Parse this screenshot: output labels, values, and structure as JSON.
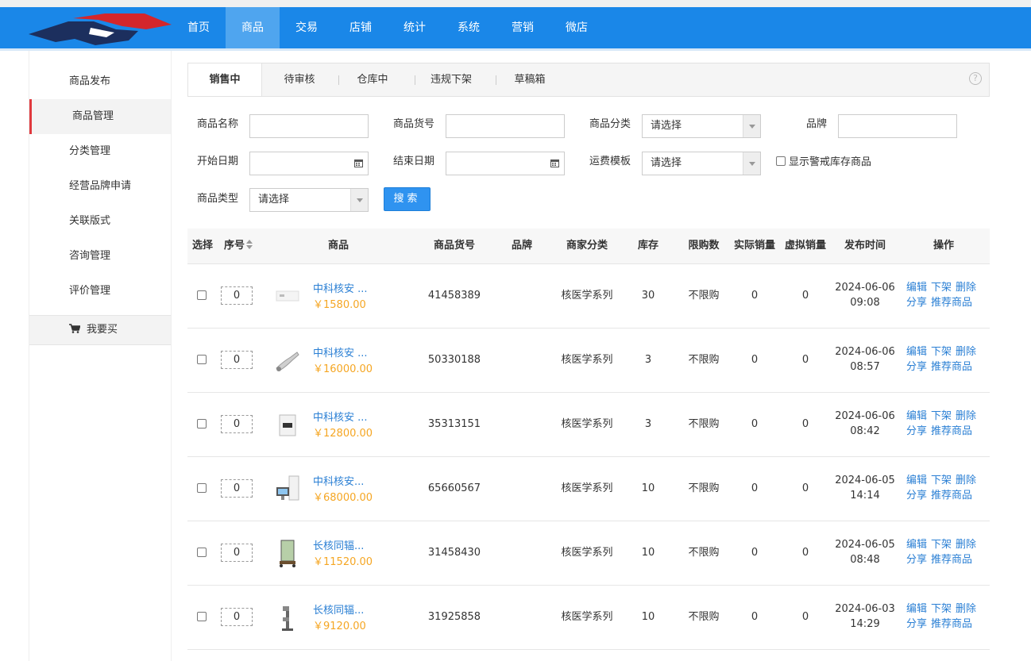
{
  "nav": {
    "items": [
      "首页",
      "商品",
      "交易",
      "店铺",
      "统计",
      "系统",
      "营销",
      "微店"
    ],
    "active": 1
  },
  "sidebar": {
    "items": [
      "商品发布",
      "商品管理",
      "分类管理",
      "经营品牌申请",
      "关联版式",
      "咨询管理",
      "评价管理"
    ],
    "active": 1,
    "buy_label": "我要买"
  },
  "tabs": {
    "items": [
      "销售中",
      "待审核",
      "仓库中",
      "违规下架",
      "草稿箱"
    ],
    "active": 0,
    "help": "?"
  },
  "filters": {
    "name_label": "商品名称",
    "sku_label": "商品货号",
    "category_label": "商品分类",
    "category_value": "请选择",
    "brand_label": "品牌",
    "start_label": "开始日期",
    "end_label": "结束日期",
    "freight_label": "运费模板",
    "freight_value": "请选择",
    "warn_label": "显示警戒库存商品",
    "type_label": "商品类型",
    "type_value": "请选择",
    "search_button": "搜索"
  },
  "table": {
    "headers": {
      "select": "选择",
      "seq": "序号",
      "product": "商品",
      "sku": "商品货号",
      "brand": "品牌",
      "category": "商家分类",
      "stock": "库存",
      "limit": "限购数",
      "real_sales": "实际销量",
      "virtual_sales": "虚拟销量",
      "publish": "发布时间",
      "ops": "操作"
    },
    "actions": [
      "编辑",
      "下架",
      "删除",
      "分享",
      "推荐商品"
    ],
    "rows": [
      {
        "seq": "0",
        "name": "中科核安 ...",
        "price": "￥1580.00",
        "sku": "41458389",
        "brand": "",
        "category": "核医学系列",
        "stock": "30",
        "limit": "不限购",
        "real": "0",
        "virtual": "0",
        "date": "2024-06-06",
        "time": "09:08",
        "thumb": "box"
      },
      {
        "seq": "0",
        "name": "中科核安 ...",
        "price": "￥16000.00",
        "sku": "50330188",
        "brand": "",
        "category": "核医学系列",
        "stock": "3",
        "limit": "不限购",
        "real": "0",
        "virtual": "0",
        "date": "2024-06-06",
        "time": "08:57",
        "thumb": "probe"
      },
      {
        "seq": "0",
        "name": "中科核安 ...",
        "price": "￥12800.00",
        "sku": "35313151",
        "brand": "",
        "category": "核医学系列",
        "stock": "3",
        "limit": "不限购",
        "real": "0",
        "virtual": "0",
        "date": "2024-06-06",
        "time": "08:42",
        "thumb": "panel"
      },
      {
        "seq": "0",
        "name": "中科核安...",
        "price": "￥68000.00",
        "sku": "65660567",
        "brand": "",
        "category": "核医学系列",
        "stock": "10",
        "limit": "不限购",
        "real": "0",
        "virtual": "0",
        "date": "2024-06-05",
        "time": "14:14",
        "thumb": "station"
      },
      {
        "seq": "0",
        "name": "长核同辐...",
        "price": "￥11520.00",
        "sku": "31458430",
        "brand": "",
        "category": "核医学系列",
        "stock": "10",
        "limit": "不限购",
        "real": "0",
        "virtual": "0",
        "date": "2024-06-05",
        "time": "08:48",
        "thumb": "screen"
      },
      {
        "seq": "0",
        "name": "长核同辐...",
        "price": "￥9120.00",
        "sku": "31925858",
        "brand": "",
        "category": "核医学系列",
        "stock": "10",
        "limit": "不限购",
        "real": "0",
        "virtual": "0",
        "date": "2024-06-03",
        "time": "14:29",
        "thumb": "stand"
      }
    ]
  },
  "colors": {
    "topbar": "#1a87e8",
    "nav_active": "#4fa5ef",
    "link": "#2a7fd4",
    "price": "#f5a623",
    "side_active_bar": "#e0393e"
  }
}
